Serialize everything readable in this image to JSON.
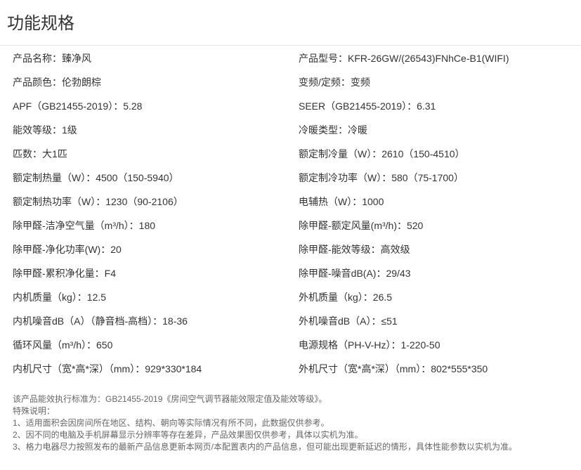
{
  "page": {
    "title": "功能规格"
  },
  "specs": {
    "rows": [
      {
        "left": "产品名称：臻净风",
        "right": "产品型号：KFR-26GW/(26543)FNhCe-B1(WIFI)"
      },
      {
        "left": "产品颜色：伦勃朗棕",
        "right": "变频/定频：变频"
      },
      {
        "left": "APF（GB21455-2019）：5.28",
        "right": "SEER（GB21455-2019）：6.31"
      },
      {
        "left": "能效等级：1级",
        "right": "冷暖类型：冷暖"
      },
      {
        "left": "匹数：大1匹",
        "right": "额定制冷量（W）：2610（150-4510）"
      },
      {
        "left": "额定制热量（W）：4500（150-5940）",
        "right": "额定制冷功率（W）：580（75-1700）"
      },
      {
        "left": "额定制热功率（W）：1230（90-2106）",
        "right": "电辅热（W）：1000"
      },
      {
        "left": "除甲醛-洁净空气量（m³/h）：180",
        "right": "除甲醛-额定风量(m³/h)：520"
      },
      {
        "left": "除甲醛-净化功率(W)：20",
        "right": "除甲醛-能效等级：高效级"
      },
      {
        "left": "除甲醛-累积净化量：F4",
        "right": "除甲醛-噪音dB(A)：29/43"
      },
      {
        "left": "内机质量（kg）：12.5",
        "right": "外机质量（kg）：26.5"
      },
      {
        "left": "内机噪音dB（A）（静音档-高档）：18-36",
        "right": "外机噪音dB（A）：≤51"
      },
      {
        "left": "循环风量（m³/h）：650",
        "right": "电源规格（PH-V-Hz）：1-220-50"
      },
      {
        "left": "内机尺寸（宽*高*深）（mm）：929*330*184",
        "right": "外机尺寸（宽*高*深）（mm）：802*555*350"
      }
    ]
  },
  "notes": {
    "lines": [
      "该产品能效执行标准为：GB21455-2019《房间空气调节器能效限定值及能效等级》。",
      "特殊说明：",
      "1、适用面积会因房间所在地区、结构、朝向等实际情况有所不同，此数据仅供参考。",
      "2、因不同的电脑及手机屏幕显示分辨率等存在差异，产品效果图仅供参考，具体以实机为准。",
      "3、格力电器尽力按照发布的最新产品信息更新本网页/本配置表内的产品信息，但可能出现更新延迟的情形，具体性能参数以实机为准。"
    ]
  }
}
